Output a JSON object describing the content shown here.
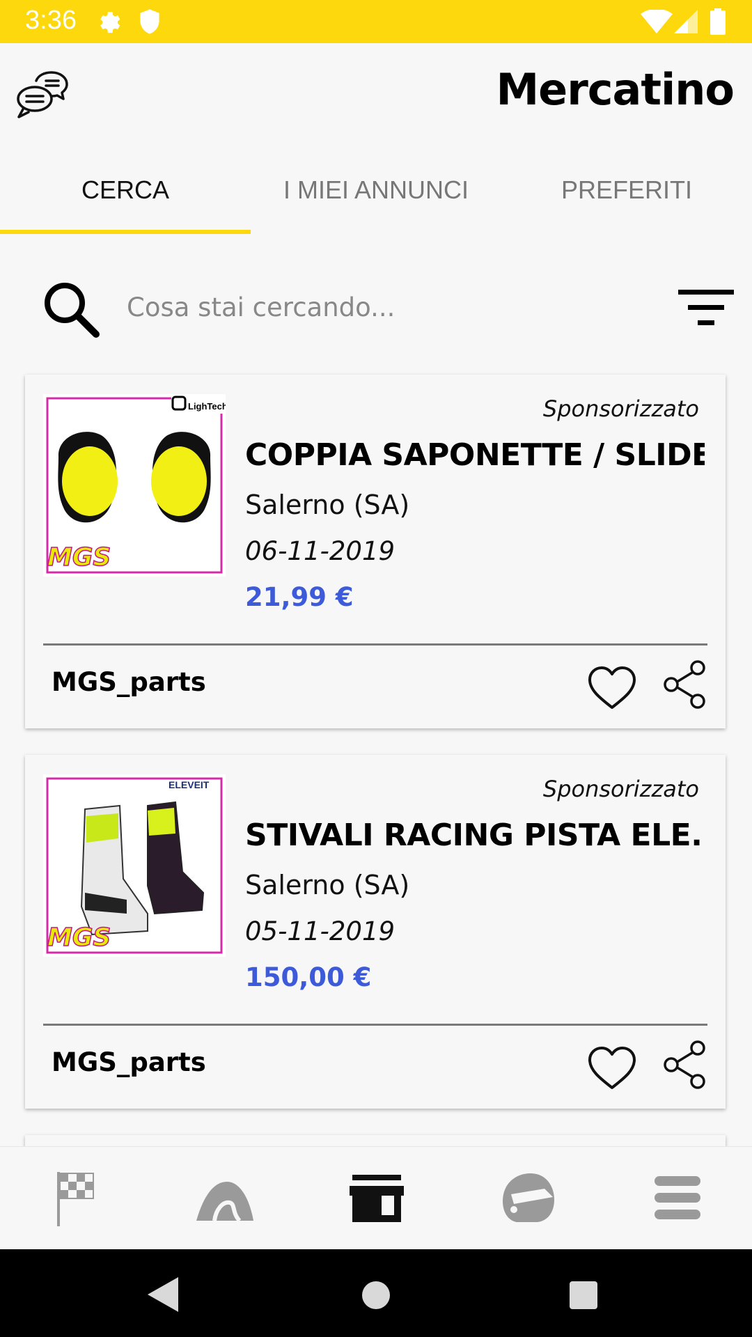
{
  "status_bar": {
    "time": "3:36"
  },
  "header": {
    "title": "Mercatino"
  },
  "tabs": [
    {
      "label": "CERCA",
      "active": true
    },
    {
      "label": "I MIEI ANNUNCI",
      "active": false
    },
    {
      "label": "PREFERITI",
      "active": false
    }
  ],
  "search": {
    "placeholder": "Cosa stai cercando..."
  },
  "listings": [
    {
      "sponsored_label": "Sponsorizzato",
      "title": "COPPIA SAPONETTE / SLIDE...",
      "location": "Salerno (SA)",
      "date": "06-11-2019",
      "price": "21,99 €",
      "seller": "MGS_parts",
      "image_brand": "LighTech"
    },
    {
      "sponsored_label": "Sponsorizzato",
      "title": "STIVALI RACING PISTA ELE...",
      "location": "Salerno (SA)",
      "date": "05-11-2019",
      "price": "150,00 €",
      "seller": "MGS_parts",
      "image_brand": "ELEVEIT"
    }
  ],
  "bottom_nav": [
    {
      "icon": "checkered-flag-icon",
      "active": false
    },
    {
      "icon": "track-road-icon",
      "active": false
    },
    {
      "icon": "store-icon",
      "active": true
    },
    {
      "icon": "helmet-icon",
      "active": false
    },
    {
      "icon": "menu-icon",
      "active": false
    }
  ],
  "colors": {
    "accent": "#fcd80c",
    "price": "#3d5bd9",
    "nav_inactive": "#9a9a9a",
    "nav_active": "#111111"
  }
}
